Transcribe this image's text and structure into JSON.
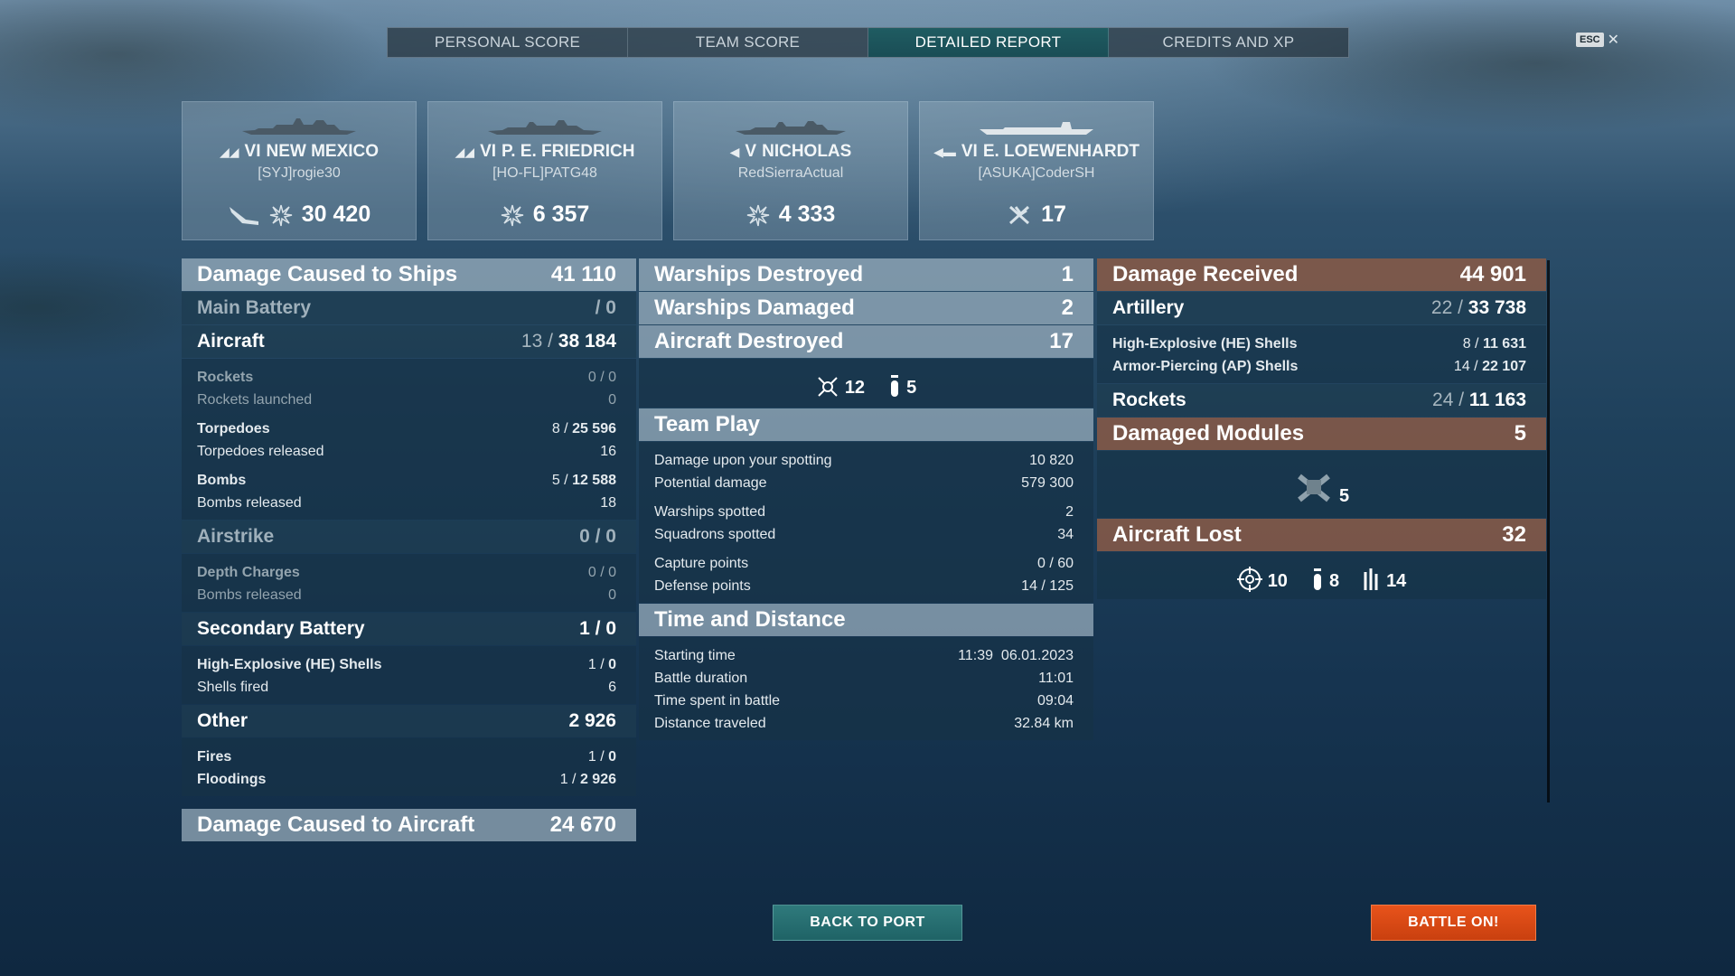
{
  "tabs": [
    {
      "label": "PERSONAL SCORE"
    },
    {
      "label": "TEAM SCORE"
    },
    {
      "label": "DETAILED REPORT",
      "active": true
    },
    {
      "label": "CREDITS AND XP"
    }
  ],
  "esc": {
    "key": "ESC",
    "close": "✕"
  },
  "cards": [
    {
      "tier": "VI",
      "name": "NEW MEXICO",
      "player": "[SYJ]rogie30",
      "stat": "30 420",
      "icons": [
        "plane-icon",
        "damage-burst-icon"
      ]
    },
    {
      "tier": "VI",
      "name": "P. E. FRIEDRICH",
      "player": "[HO-FL]PATG48",
      "stat": "6 357",
      "icons": [
        "damage-burst-icon"
      ]
    },
    {
      "tier": "V",
      "name": "NICHOLAS",
      "player": "RedSierraActual",
      "stat": "4 333",
      "icons": [
        "damage-burst-icon"
      ]
    },
    {
      "tier": "VI",
      "name": "E. LOEWENHARDT",
      "player": "[ASUKA]CoderSH",
      "stat": "17",
      "icons": [
        "plane-kill-icon"
      ]
    }
  ],
  "damage": {
    "title": "Damage Caused to Ships",
    "total": "41 110",
    "main_battery": {
      "label": "Main Battery",
      "value": "/ 0"
    },
    "aircraft": {
      "label": "Aircraft",
      "hits": "13",
      "value": "38 184"
    },
    "rockets": {
      "label": "Rockets",
      "hits": "0",
      "value": "0"
    },
    "rockets_launched": {
      "label": "Rockets launched",
      "value": "0"
    },
    "torpedoes": {
      "label": "Torpedoes",
      "hits": "8",
      "value": "25 596"
    },
    "torpedoes_released": {
      "label": "Torpedoes released",
      "value": "16"
    },
    "bombs": {
      "label": "Bombs",
      "hits": "5",
      "value": "12 588"
    },
    "bombs_released": {
      "label": "Bombs released",
      "value": "18"
    },
    "airstrike": {
      "label": "Airstrike",
      "value": "0 / 0"
    },
    "depth_charges": {
      "label": "Depth Charges",
      "value": "0 / 0"
    },
    "bombs_released2": {
      "label": "Bombs released",
      "value": "0"
    },
    "secondary": {
      "label": "Secondary Battery",
      "hits": "1",
      "value": "0"
    },
    "he_shells": {
      "label": "High-Explosive (HE) Shells",
      "hits": "1",
      "value": "0"
    },
    "shells_fired": {
      "label": "Shells fired",
      "value": "6"
    },
    "other": {
      "label": "Other",
      "value": "2 926"
    },
    "fires": {
      "label": "Fires",
      "hits": "1",
      "value": "0"
    },
    "floodings": {
      "label": "Floodings",
      "hits": "1",
      "value": "2 926"
    },
    "aircraft_dmg": {
      "label": "Damage Caused to Aircraft",
      "value": "24 670"
    }
  },
  "kills": {
    "warships_destroyed": {
      "label": "Warships Destroyed",
      "value": "1"
    },
    "warships_damaged": {
      "label": "Warships Damaged",
      "value": "2"
    },
    "aircraft_destroyed": {
      "label": "Aircraft Destroyed",
      "value": "17"
    },
    "fighters": "12",
    "bombers": "5"
  },
  "teamplay": {
    "title": "Team Play",
    "rows": [
      {
        "label": "Damage upon your spotting",
        "value": "10 820"
      },
      {
        "label": "Potential damage",
        "value": "579 300"
      },
      {
        "label": "Warships spotted",
        "value": "2"
      },
      {
        "label": "Squadrons spotted",
        "value": "34"
      },
      {
        "label": "Capture points",
        "value": "0 / 60"
      },
      {
        "label": "Defense points",
        "value": "14 / 125"
      }
    ]
  },
  "time": {
    "title": "Time and Distance",
    "rows": [
      {
        "label": "Starting time",
        "value": "11:39  06.01.2023"
      },
      {
        "label": "Battle duration",
        "value": "11:01"
      },
      {
        "label": "Time spent in battle",
        "value": "09:04"
      },
      {
        "label": "Distance traveled",
        "value": "32.84 km"
      }
    ]
  },
  "received": {
    "title": "Damage Received",
    "total": "44 901",
    "artillery": {
      "label": "Artillery",
      "hits": "22",
      "value": "33 738"
    },
    "he": {
      "label": "High-Explosive (HE) Shells",
      "hits": "8",
      "value": "11 631"
    },
    "ap": {
      "label": "Armor-Piercing (AP) Shells",
      "hits": "14",
      "value": "22 107"
    },
    "rockets": {
      "label": "Rockets",
      "hits": "24",
      "value": "11 163"
    },
    "modules": {
      "label": "Damaged Modules",
      "value": "5",
      "hangar": "5"
    },
    "aircraft_lost": {
      "label": "Aircraft Lost",
      "value": "32",
      "fighters": "10",
      "bombers": "8",
      "rocket_planes": "14"
    }
  },
  "buttons": {
    "back": "BACK TO PORT",
    "battle": "BATTLE ON!"
  },
  "colors": {
    "accent_teal": "#1f5c62",
    "battle_orange": "#d9481a",
    "received_brown": "#8a5a46"
  }
}
